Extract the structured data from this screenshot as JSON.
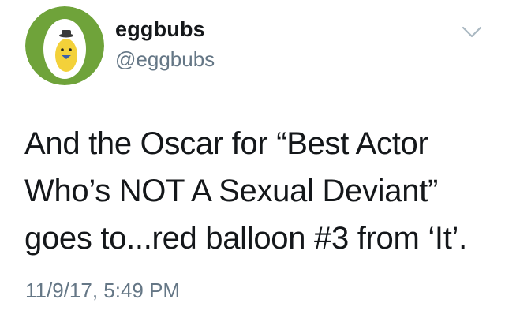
{
  "author": {
    "display_name": "eggbubs",
    "handle": "@eggbubs",
    "avatar": "egg-character-avatar"
  },
  "menu": {
    "icon": "chevron-down-icon"
  },
  "tweet": {
    "lines": [
      "And the Oscar for “Best Actor",
      "Who’s NOT A Sexual Deviant”",
      "goes to...red balloon #3 from ‘It’."
    ],
    "timestamp": "11/9/17, 5:49 PM"
  },
  "colors": {
    "text": "#14171a",
    "secondary": "#657786",
    "avatar_ring": "#6fa33a",
    "chevron": "#aab8c2"
  }
}
